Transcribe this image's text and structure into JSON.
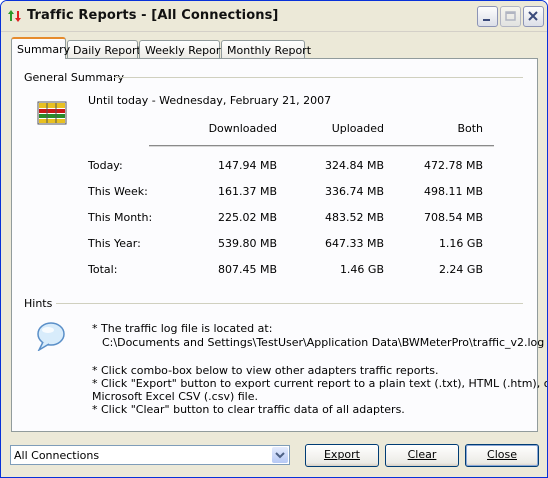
{
  "window": {
    "title": "Traffic Reports - [All Connections]"
  },
  "tabs": [
    {
      "label": "Summary",
      "active": true
    },
    {
      "label": "Daily Report",
      "active": false
    },
    {
      "label": "Weekly Report",
      "active": false
    },
    {
      "label": "Monthly Report",
      "active": false
    }
  ],
  "summary": {
    "section_title": "General Summary",
    "date_text": "Until today - Wednesday, February 21, 2007",
    "columns": [
      "Downloaded",
      "Uploaded",
      "Both"
    ],
    "rows": [
      {
        "label": "Today:",
        "downloaded": "147.94 MB",
        "uploaded": "324.84 MB",
        "both": "472.78 MB"
      },
      {
        "label": "This Week:",
        "downloaded": "161.37 MB",
        "uploaded": "336.74 MB",
        "both": "498.11 MB"
      },
      {
        "label": "This Month:",
        "downloaded": "225.02 MB",
        "uploaded": "483.52 MB",
        "both": "708.54 MB"
      },
      {
        "label": "This Year:",
        "downloaded": "539.80 MB",
        "uploaded": "647.33 MB",
        "both": "1.16 GB"
      },
      {
        "label": "Total:",
        "downloaded": "807.45 MB",
        "uploaded": "1.46 GB",
        "both": "2.24 GB"
      }
    ]
  },
  "hints": {
    "section_title": "Hints",
    "line1": "* The traffic log file is located at:",
    "line2": "C:\\Documents and Settings\\TestUser\\Application Data\\BWMeterPro\\traffic_v2.log",
    "line3": "* Click combo-box below to view other adapters traffic reports.",
    "line4": "* Click \"Export\" button to export current report to a plain text (.txt), HTML (.htm), or",
    "line5": "Microsoft Excel CSV (.csv) file.",
    "line6": "* Click \"Clear\" button to clear traffic data of all adapters."
  },
  "footer": {
    "adapter_select": "All Connections",
    "export_label": "Export",
    "clear_label": "Clear",
    "close_label": "Close"
  },
  "colors": {
    "accent_tab": "#e68b2c",
    "window_bg": "#ece9d8"
  }
}
